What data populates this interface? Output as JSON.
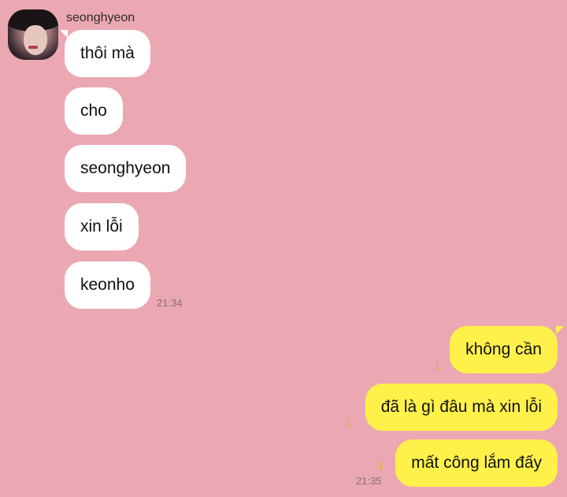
{
  "chat": {
    "sender_name": "seonghyeon",
    "incoming": [
      "thôi mà",
      "cho",
      "seonghyeon",
      "xin lỗi",
      "keonho"
    ],
    "incoming_time": "21:34",
    "outgoing": [
      "không cần",
      "đã là gì đâu mà xin lỗi",
      "mất công lắm đấy"
    ],
    "outgoing_unread": [
      "1",
      "1",
      "1"
    ],
    "outgoing_time": "21:35"
  },
  "colors": {
    "background": "#eba8b2",
    "incoming_bubble": "#ffffff",
    "outgoing_bubble": "#fff149",
    "unread_count": "#d9b600"
  }
}
